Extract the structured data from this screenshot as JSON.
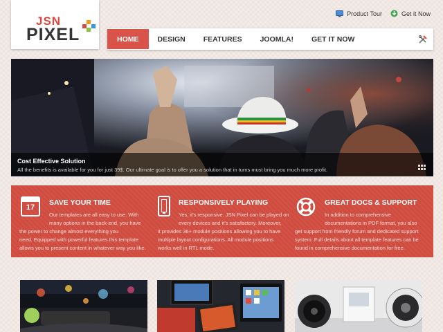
{
  "logo": {
    "line1": "JSN",
    "line2": "PIXEL"
  },
  "top_links": [
    {
      "label": "Product Tour",
      "icon": "monitor-icon"
    },
    {
      "label": "Get it Now",
      "icon": "download-icon"
    }
  ],
  "nav": {
    "items": [
      {
        "label": "HOME",
        "active": true
      },
      {
        "label": "DESIGN",
        "active": false
      },
      {
        "label": "FEATURES",
        "active": false
      },
      {
        "label": "JOOMLA!",
        "active": false
      },
      {
        "label": "GET IT NOW",
        "active": false
      }
    ],
    "tools_icon": "tools-icon"
  },
  "slider": {
    "caption_title": "Cost Effective Solution",
    "caption_text": "All the benefits is available for you for just 39$. Our ultimate goal is to offer you a solution that in turns must bring you much more profit."
  },
  "features": [
    {
      "title": "SAVE YOUR TIME",
      "icon": "calendar-icon",
      "icon_text": "17",
      "lines": [
        "Our templates are all easy to use. With",
        "many options in the back-end, you have",
        "the power to change almost everything you",
        "need. Equipped with powerful features this template",
        "allows you to present content in whatever way you like."
      ]
    },
    {
      "title": "RESPONSIVELY PLAYING",
      "icon": "phone-icon",
      "lines": [
        "Yes, it's responsive. JSN Pixel can be played on",
        "every devices and it's satisfactory. Moreover,",
        "it provides 36+ module positions allowing you to have",
        "multiple layout configurations. All module positions",
        "works well in RTL mode."
      ]
    },
    {
      "title": "GREAT DOCS & SUPPORT",
      "icon": "lifebuoy-icon",
      "lines": [
        "In addition to comprehensive",
        "documentations in PDF format, you also",
        "get support from friendly forum and dedicated support",
        "system. Full details about all template features can be",
        "found in comprehensive documentation for free."
      ]
    }
  ],
  "colors": {
    "accent": "#d9534a",
    "feature_bg": "#d04c40",
    "logo_red": "#d84a3d"
  }
}
